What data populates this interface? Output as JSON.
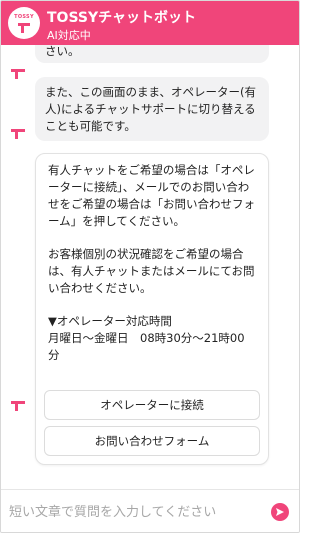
{
  "header": {
    "logo_text": "TOSSY",
    "title": "TOSSYチャットボット",
    "subtitle": "AI対応中"
  },
  "messages": [
    {
      "text": "さい。"
    },
    {
      "text": "また、この画面のまま、オペレーター(有人)によるチャットサポートに切り替えることも可能です。"
    },
    {
      "paragraph1": "有人チャットをご希望の場合は「オペレーターに接続」、メールでのお問い合わせをご希望の場合は「お問い合わせフォーム」を押してください。",
      "paragraph2": "お客様個別の状況確認をご希望の場合は、有人チャットまたはメールにてお問い合わせください。",
      "hours_title": "▼オペレーター対応時間",
      "hours": "月曜日〜金曜日　08時30分〜21時00分",
      "buttons": [
        "オペレーターに接続",
        "お問い合わせフォーム"
      ]
    }
  ],
  "input": {
    "placeholder": "短い文章で質問を入力してください"
  },
  "colors": {
    "accent": "#f0457a",
    "bubble": "#f2f2f3"
  },
  "icons": [
    "bot-avatar-icon",
    "send-icon"
  ]
}
